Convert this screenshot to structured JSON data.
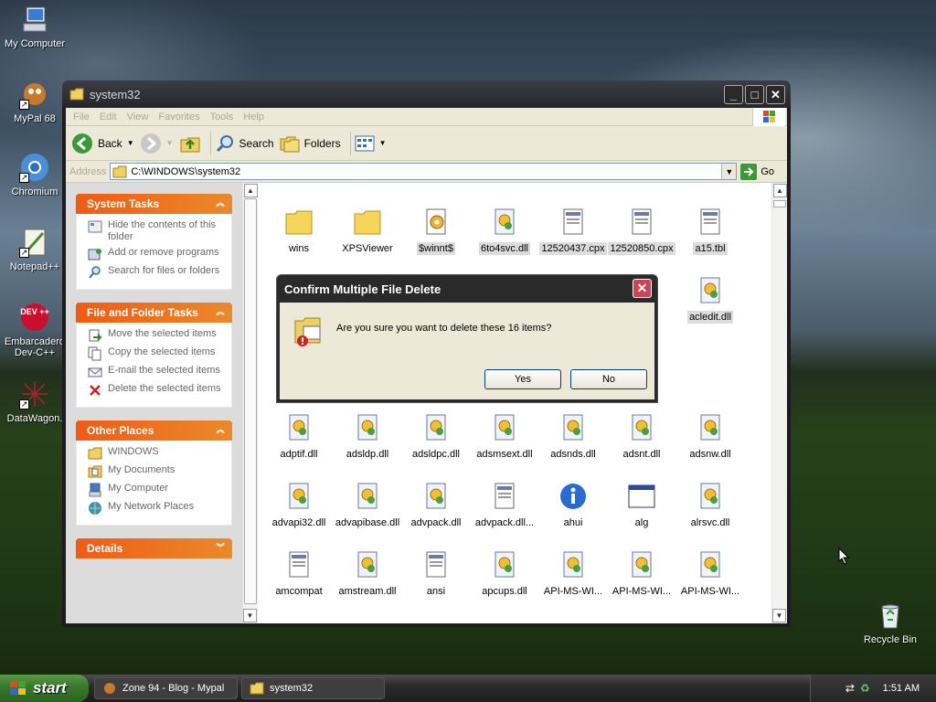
{
  "desktop": {
    "icons": [
      {
        "label": "My Computer"
      },
      {
        "label": "MyPal 68"
      },
      {
        "label": "Chromium"
      },
      {
        "label": "Notepad++"
      },
      {
        "label": "Embarcadero Dev-C++",
        "line1": "Embarcadero",
        "line2": "Dev-C++",
        "badge": "DEV ++"
      },
      {
        "label": "DataWagon."
      },
      {
        "label": "Recycle Bin"
      }
    ]
  },
  "window": {
    "title": "system32",
    "controls": {
      "minimize": "_",
      "maximize": "□",
      "close": "✕"
    },
    "menu": [
      "File",
      "Edit",
      "View",
      "Favorites",
      "Tools",
      "Help"
    ],
    "toolbar": {
      "back": "Back",
      "search": "Search",
      "folders": "Folders"
    },
    "address": {
      "label": "Address",
      "value": "C:\\WINDOWS\\system32",
      "go": "Go"
    }
  },
  "sidebar": {
    "system_tasks": {
      "title": "System Tasks",
      "items": [
        "Hide the contents of this folder",
        "Add or remove programs",
        "Search for files or folders"
      ]
    },
    "file_tasks": {
      "title": "File and Folder Tasks",
      "items": [
        "Move the selected items",
        "Copy the selected items",
        "E-mail the selected items",
        "Delete the selected items"
      ]
    },
    "other_places": {
      "title": "Other Places",
      "items": [
        "WINDOWS",
        "My Documents",
        "My Computer",
        "My Network Places"
      ]
    },
    "details": {
      "title": "Details"
    }
  },
  "files": [
    {
      "name": "wins",
      "icon": "folder-icon"
    },
    {
      "name": "XPSViewer",
      "icon": "folder-icon"
    },
    {
      "name": "$winnt$",
      "icon": "settings-file-icon",
      "selected": true
    },
    {
      "name": "6to4svc.dll",
      "icon": "dll-icon",
      "selected": true
    },
    {
      "name": "12520437.cpx",
      "icon": "doc-icon",
      "selected": true
    },
    {
      "name": "12520850.cpx",
      "icon": "doc-icon",
      "selected": true
    },
    {
      "name": "a15.tbl",
      "icon": "doc-icon",
      "selected": true
    },
    {
      "name": "acledit.dll",
      "icon": "dll-icon",
      "selected": true
    },
    {
      "name": "adptif.dll",
      "icon": "dll-icon"
    },
    {
      "name": "adsldp.dll",
      "icon": "dll-icon"
    },
    {
      "name": "adsldpc.dll",
      "icon": "dll-icon"
    },
    {
      "name": "adsmsext.dll",
      "icon": "dll-icon"
    },
    {
      "name": "adsnds.dll",
      "icon": "dll-icon"
    },
    {
      "name": "adsnt.dll",
      "icon": "dll-icon"
    },
    {
      "name": "adsnw.dll",
      "icon": "dll-icon"
    },
    {
      "name": "advapi32.dll",
      "icon": "dll-icon"
    },
    {
      "name": "advapibase.dll",
      "icon": "dll-icon"
    },
    {
      "name": "advpack.dll",
      "icon": "dll-icon"
    },
    {
      "name": "advpack.dll...",
      "icon": "doc-icon"
    },
    {
      "name": "ahui",
      "icon": "info-icon"
    },
    {
      "name": "alg",
      "icon": "window-icon"
    },
    {
      "name": "alrsvc.dll",
      "icon": "dll-icon"
    },
    {
      "name": "amcompat",
      "icon": "doc-icon"
    },
    {
      "name": "amstream.dll",
      "icon": "dll-icon"
    },
    {
      "name": "ansi",
      "icon": "doc-icon"
    },
    {
      "name": "apcups.dll",
      "icon": "dll-icon"
    },
    {
      "name": "API-MS-WI...",
      "icon": "dll-icon"
    },
    {
      "name": "API-MS-WI...",
      "icon": "dll-icon"
    },
    {
      "name": "API-MS-WI...",
      "icon": "dll-icon"
    }
  ],
  "dialog": {
    "title": "Confirm Multiple File Delete",
    "message": "Are you sure you want to delete these 16 items?",
    "yes": "Yes",
    "no": "No",
    "close": "✕"
  },
  "taskbar": {
    "start": "start",
    "tasks": [
      {
        "label": "Zone 94 - Blog - Mypal"
      },
      {
        "label": "system32"
      }
    ],
    "clock": "1:51 AM"
  }
}
